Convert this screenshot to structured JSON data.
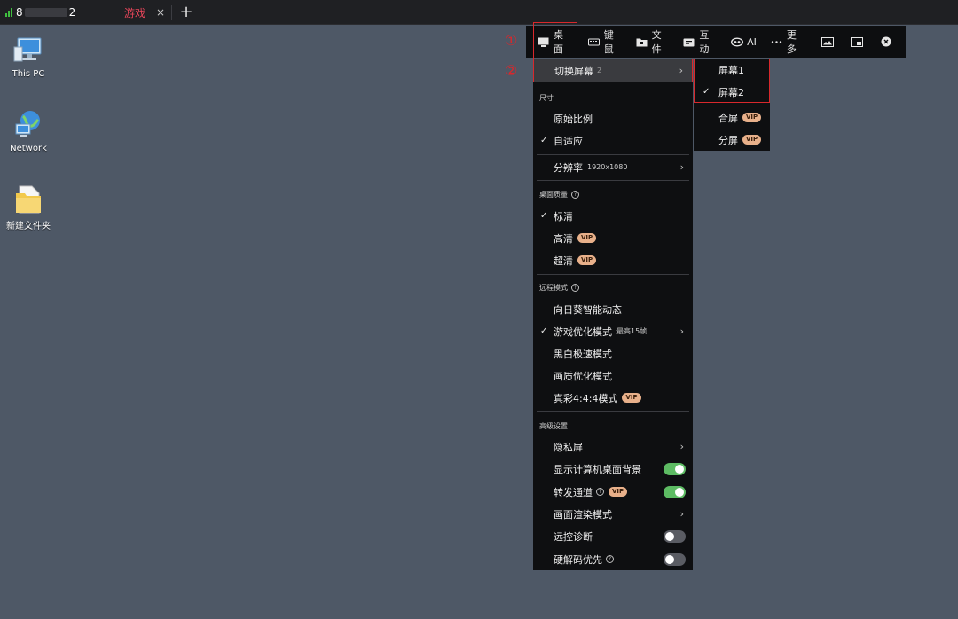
{
  "tabbar": {
    "tab1": {
      "title_start": "8",
      "title_end": "2"
    },
    "tab2": {
      "label": "游戏",
      "close": "×"
    },
    "add": "+"
  },
  "desktop": {
    "icons": [
      {
        "label": "This PC"
      },
      {
        "label": "Network"
      },
      {
        "label": "新建文件夹"
      }
    ]
  },
  "toolbar": {
    "desktop": "桌面",
    "keyboard_mouse": "键鼠",
    "file": "文件",
    "interact": "互动",
    "ai": "AI",
    "more": "更多"
  },
  "annotations": {
    "one": "①",
    "two": "②"
  },
  "menu": {
    "switch_screen": {
      "label": "切换屏幕",
      "count": "2"
    },
    "size": {
      "title": "尺寸",
      "original": "原始比例",
      "adaptive": "自适应"
    },
    "resolution": {
      "label": "分辨率",
      "value": "1920x1080"
    },
    "quality": {
      "title": "桌面质量",
      "standard": "标清",
      "high": "高清",
      "ultra": "超清"
    },
    "remote_mode": {
      "title": "远程模式",
      "smart": "向日葵智能动态",
      "game": "游戏优化模式",
      "game_sub": "最高15帧",
      "bw": "黑白极速模式",
      "image": "画质优化模式",
      "true_color": "真彩4:4:4模式"
    },
    "advanced": {
      "title": "高级设置",
      "privacy": "隐私屏",
      "show_bg": "显示计算机桌面背景",
      "relay": "转发通道",
      "render": "画面渲染模式",
      "diagnose": "远控诊断",
      "hw_decode": "硬解码优先"
    },
    "vip": "VIP",
    "check": "✓",
    "arrow": "›",
    "help": "?"
  },
  "submenu": {
    "screen1": "屏幕1",
    "screen2": "屏幕2",
    "merge": "合屏",
    "split": "分屏"
  },
  "toggles": {
    "show_bg": true,
    "relay": true,
    "diagnose": false,
    "hw_decode": false
  },
  "colors": {
    "accent_red": "#d8282c",
    "toggle_on": "#5dbb63",
    "vip_bg": "#e8b08a",
    "desktop_bg": "#4e5866"
  }
}
